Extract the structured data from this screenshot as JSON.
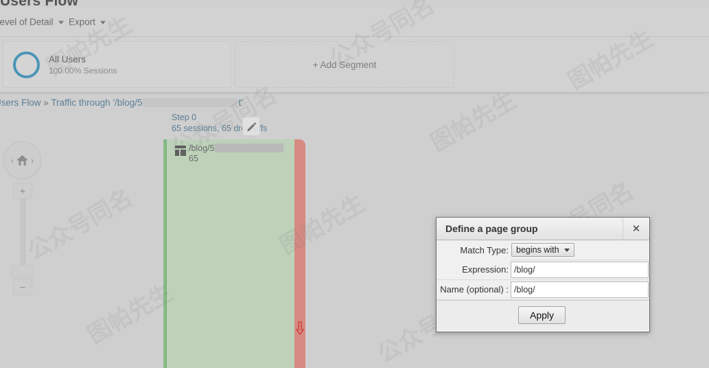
{
  "page": {
    "title": "Users Flow"
  },
  "toolbar": {
    "level_of_detail": "Level of Detail",
    "export": "Export"
  },
  "segments": {
    "all_users_name": "All Users",
    "all_users_sub": "100.00% Sessions",
    "add_segment": "+ Add Segment"
  },
  "breadcrumb": {
    "root": "Users Flow",
    "separator": "»",
    "trail_prefix": "Traffic through '/blog/5",
    "trail_suffix": "t'"
  },
  "flow": {
    "step_title": "Step 0",
    "step_stats": "65 sessions, 65 drop-offs",
    "node_label": "/blog/5",
    "node_count": "65",
    "edit_icon": "pencil-icon",
    "node_icon": "page-template-icon",
    "dropoff_icon": "down-arrow-icon"
  },
  "zoom_control": {
    "home_icon": "home-icon",
    "left_chevron": "‹",
    "right_chevron": "›",
    "zoom_in": "+",
    "zoom_out": "−"
  },
  "dialog": {
    "title": "Define a page group",
    "close_label": "✕",
    "match_type_label": "Match Type:",
    "match_type_value": "begins with",
    "expression_label": "Expression:",
    "expression_value": "/blog/",
    "name_label": "Name (optional) :",
    "name_value": "/blog/",
    "apply_label": "Apply"
  },
  "watermarks": [
    "图帕先生",
    "公众号同名",
    "图帕先生",
    "公众号同名",
    "图帕先生",
    "公众号同名",
    "图帕先生",
    "公众号同名",
    "图帕先生",
    "公众号同名"
  ],
  "colors": {
    "accent_blue": "#3f8fb5",
    "node_green": "#bdd2b9",
    "node_green_edge": "#79b379",
    "node_red": "#d68a82",
    "link_blue": "#5b7f96",
    "bg": "#cfcfcf"
  }
}
